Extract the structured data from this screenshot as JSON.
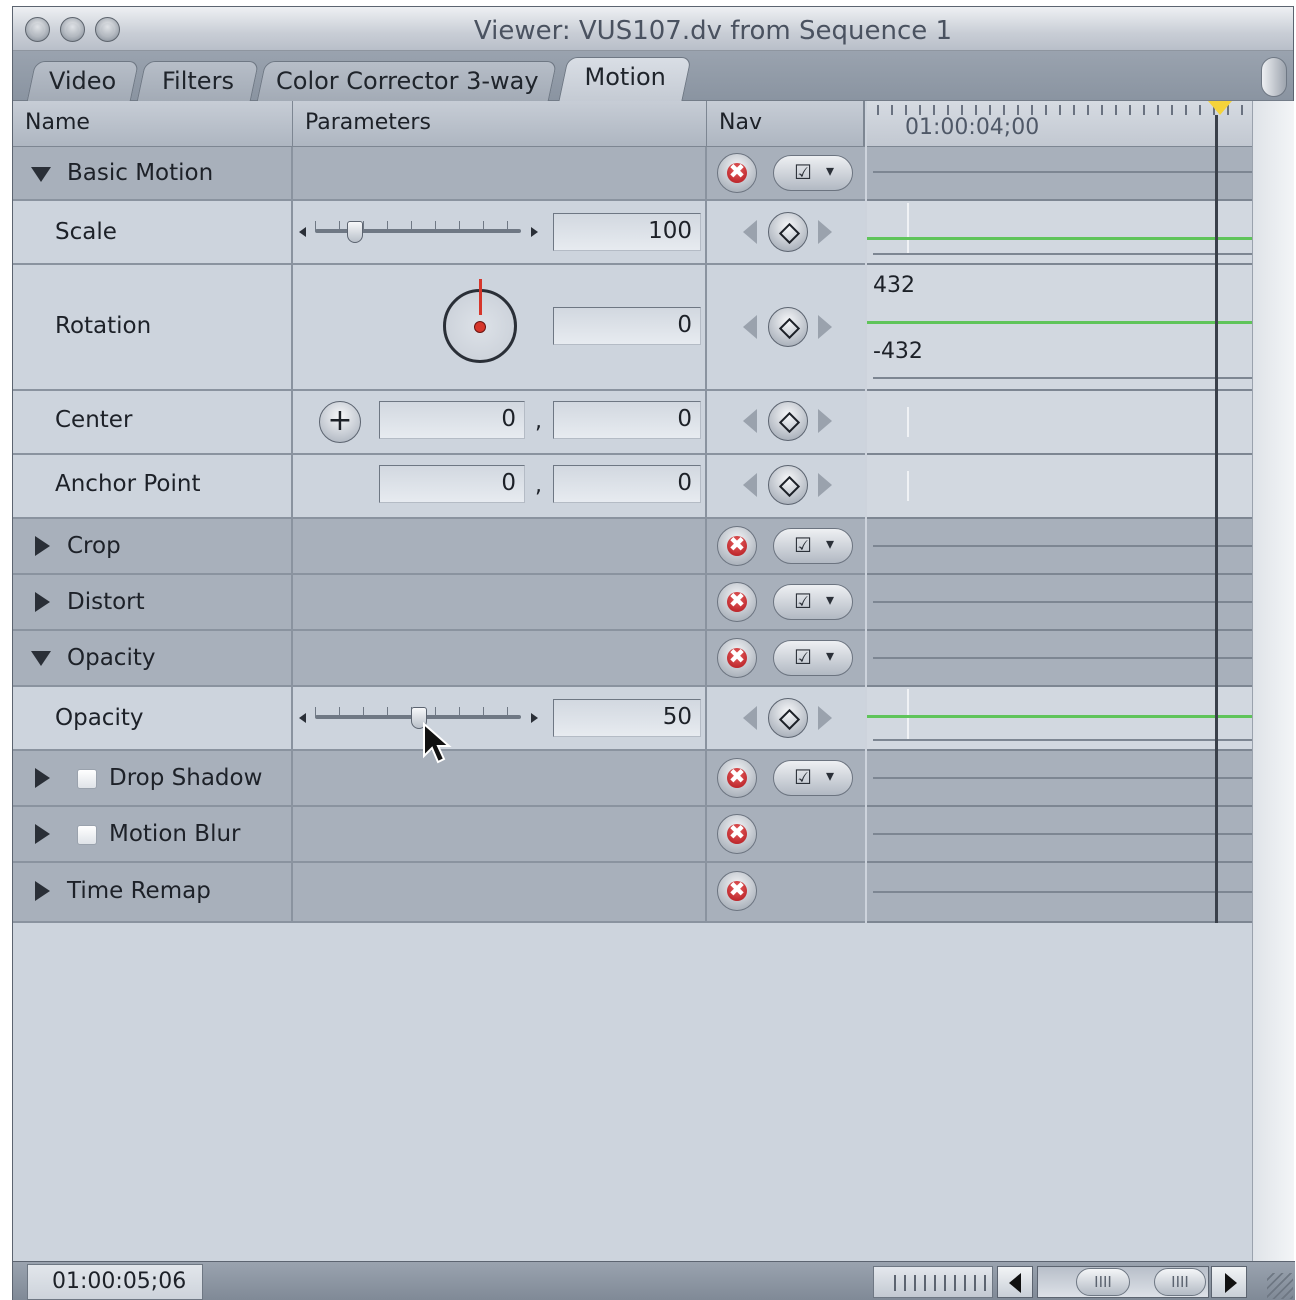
{
  "window": {
    "title": "Viewer: VUS107.dv from Sequence 1"
  },
  "tabs": [
    {
      "label": "Video"
    },
    {
      "label": "Filters"
    },
    {
      "label": "Color Corrector 3-way"
    },
    {
      "label": "Motion",
      "active": true
    }
  ],
  "columns": {
    "name": "Name",
    "parameters": "Parameters",
    "nav": "Nav"
  },
  "timeline": {
    "ruler_time": "01:00:04;00",
    "rotation_max": "432",
    "rotation_min": "-432"
  },
  "groups": {
    "basic_motion": "Basic Motion",
    "crop": "Crop",
    "distort": "Distort",
    "opacity": "Opacity",
    "drop_shadow": "Drop Shadow",
    "motion_blur": "Motion Blur",
    "time_remap": "Time Remap"
  },
  "params": {
    "scale": {
      "label": "Scale",
      "value": "100"
    },
    "rotation": {
      "label": "Rotation",
      "value": "0"
    },
    "center": {
      "label": "Center",
      "x": "0",
      "y": "0"
    },
    "anchor_point": {
      "label": "Anchor Point",
      "x": "0",
      "y": "0"
    },
    "opacity": {
      "label": "Opacity",
      "value": "50"
    }
  },
  "separator": ",",
  "icons": {
    "reset": "✖",
    "menu": "☑",
    "dropdown": "▾",
    "plus": "+",
    "grip": "IIII"
  },
  "bottom": {
    "timecode": "01:00:05;06"
  }
}
